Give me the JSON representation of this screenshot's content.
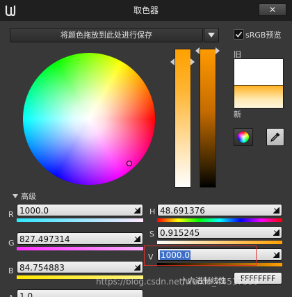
{
  "window": {
    "title": "取色器",
    "close_label": "✕"
  },
  "toolbar": {
    "save_dropdown_label": "将颜色拖放到此处进行保存",
    "srgb_label": "sRGB预览",
    "srgb_checked": true
  },
  "preview": {
    "old_label": "旧",
    "new_label": "新"
  },
  "advanced": {
    "label": "高级"
  },
  "channels": {
    "r": {
      "label": "R",
      "value": "1000.0"
    },
    "g": {
      "label": "G",
      "value": "827.497314"
    },
    "b": {
      "label": "B",
      "value": "84.754883"
    },
    "a": {
      "label": "A",
      "value": "1.0"
    },
    "h": {
      "label": "H",
      "value": "48.691376"
    },
    "s": {
      "label": "S",
      "value": "0.915245"
    },
    "v": {
      "label": "V",
      "value": "1000.0"
    }
  },
  "hex": {
    "label": "十六进制线性",
    "value": "FFFFFFFF"
  },
  "watermark": "https://blog.csdn.net/weixin_44517339",
  "colors": {
    "current_color": "#ffa000",
    "highlight": "#e0302a"
  }
}
